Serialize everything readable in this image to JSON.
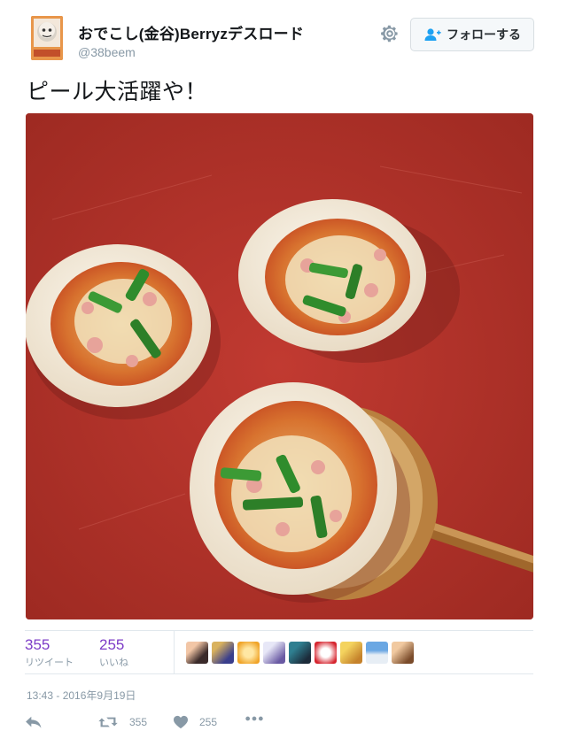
{
  "user": {
    "display_name": "おでこし(金谷)Berryzデスロード",
    "screen_name": "@38beem",
    "avatar_icon": "user-avatar"
  },
  "follow_button": {
    "label": "フォローする",
    "icon": "add-user-icon"
  },
  "settings_icon": "gear-icon",
  "tweet": {
    "text": "ピール大活躍や！",
    "photo_icon": "pizza-photo"
  },
  "stats": {
    "retweets": {
      "count": "355",
      "label": "リツイート"
    },
    "likes": {
      "count": "255",
      "label": "いいね"
    },
    "liker_avatar_count": 9
  },
  "timestamp": "13:43 - 2016年9月19日",
  "actions": {
    "reply_icon": "reply-icon",
    "retweet_icon": "retweet-icon",
    "retweet_count": "355",
    "like_icon": "heart-icon",
    "like_count": "255",
    "more_icon": "more-icon"
  },
  "colors": {
    "accent": "#7d3cc7",
    "muted": "#8899a6",
    "border": "#e1e8ed",
    "text": "#14171a",
    "cutting_board": "#b8322b"
  }
}
